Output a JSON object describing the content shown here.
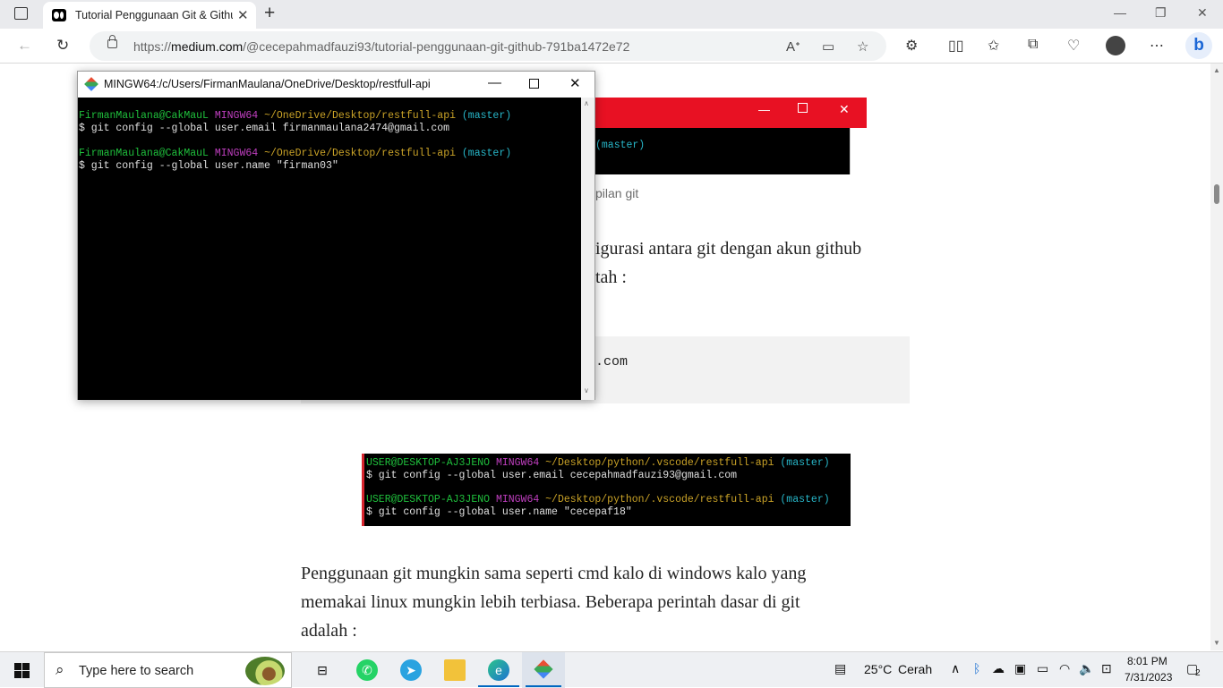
{
  "browser": {
    "tab_title": "Tutorial Penggunaan Git & Github",
    "tab_close": "✕",
    "new_tab": "+",
    "url_prefix": "https://",
    "url_domain": "medium.com",
    "url_path": "/@cecepahmadfauzi93/tutorial-penggunaan-git-github-791ba1472e72",
    "window_controls": [
      "—",
      "❐",
      "✕"
    ]
  },
  "terminal": {
    "title": "MINGW64:/c/Users/FirmanMaulana/OneDrive/Desktop/restfull-api",
    "lines": [
      {
        "user": "FirmanMaulana@CakMauL",
        "env": "MINGW64",
        "path": "~/OneDrive/Desktop/restfull-api",
        "branch": "(master)"
      },
      {
        "cmd": "$ git config --global user.email firmanmaulana2474@gmail.com"
      },
      {
        "user": "FirmanMaulana@CakMauL",
        "env": "MINGW64",
        "path": "~/OneDrive/Desktop/restfull-api",
        "branch": "(master)"
      },
      {
        "cmd": "$ git config --global user.name \"firman03\""
      }
    ]
  },
  "article": {
    "bg_shot_branch": "(master)",
    "caption_fragment": "pilan git",
    "para1_line1": "igurasi antara git dengan akun github",
    "para1_line2": "tah :",
    "code_fragment": ".com",
    "shot2": {
      "line1_user": "USER@DESKTOP-AJ3JENO",
      "line1_env": "MINGW64",
      "line1_path": "~/Desktop/python/.vscode/restfull-api",
      "line1_branch": "(master)",
      "line2": "$ git config --global user.email cecepahmadfauzi93@gmail.com",
      "line3_user": "USER@DESKTOP-AJ3JENO",
      "line3_env": "MINGW64",
      "line3_path": "~/Desktop/python/.vscode/restfull-api",
      "line3_branch": "(master)",
      "line4": "$ git config --global user.name \"cecepaf18\""
    },
    "para2_line1": "Penggunaan git mungkin sama seperti cmd kalo di windows kalo yang",
    "para2_line2": "memakai linux mungkin lebih terbiasa. Beberapa perintah dasar di git",
    "para2_line3": "adalah :"
  },
  "taskbar": {
    "search_placeholder": "Type here to search",
    "weather_temp": "25°C",
    "weather_text": "Cerah",
    "time": "8:01 PM",
    "date": "7/31/2023",
    "notifications": "2"
  }
}
